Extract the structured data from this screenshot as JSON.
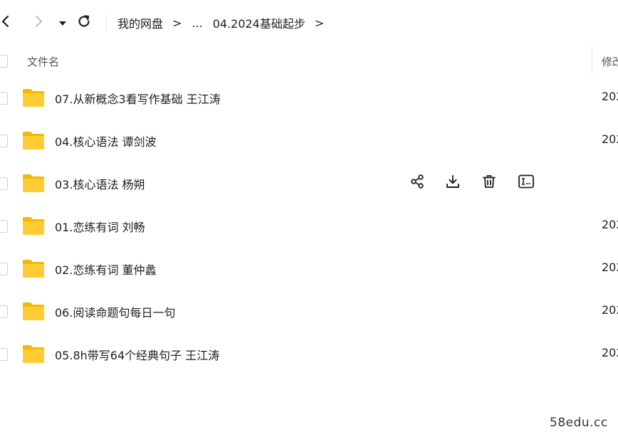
{
  "toolbar": {
    "icons": [
      "back-icon",
      "forward-icon",
      "dropdown-icon",
      "refresh-icon"
    ]
  },
  "breadcrumb": {
    "root": "我的网盘",
    "separator": ">",
    "ellipsis": "...",
    "current": "04.2024基础起步",
    "trailing": ">"
  },
  "columns": {
    "name": "文件名",
    "modified": "修改"
  },
  "files": [
    {
      "name": "07.从新概念3看写作基础 王江涛",
      "date": "202"
    },
    {
      "name": "04.核心语法 谭剑波",
      "date": "202"
    },
    {
      "name": "03.核心语法 杨朔",
      "date": ""
    },
    {
      "name": "01.恋练有词 刘畅",
      "date": "202"
    },
    {
      "name": "02.恋练有词 董仲蠡",
      "date": "202"
    },
    {
      "name": "06.阅读命题句每日一句",
      "date": "202"
    },
    {
      "name": "05.8h带写64个经典句子 王江涛",
      "date": "202"
    }
  ],
  "hover_actions": [
    "share-icon",
    "download-icon",
    "delete-icon",
    "rename-icon"
  ],
  "watermark": "58edu.cc",
  "colors": {
    "folder": "#FFCC33",
    "folder_tab": "#F5B800",
    "text": "#1f1f1f"
  }
}
